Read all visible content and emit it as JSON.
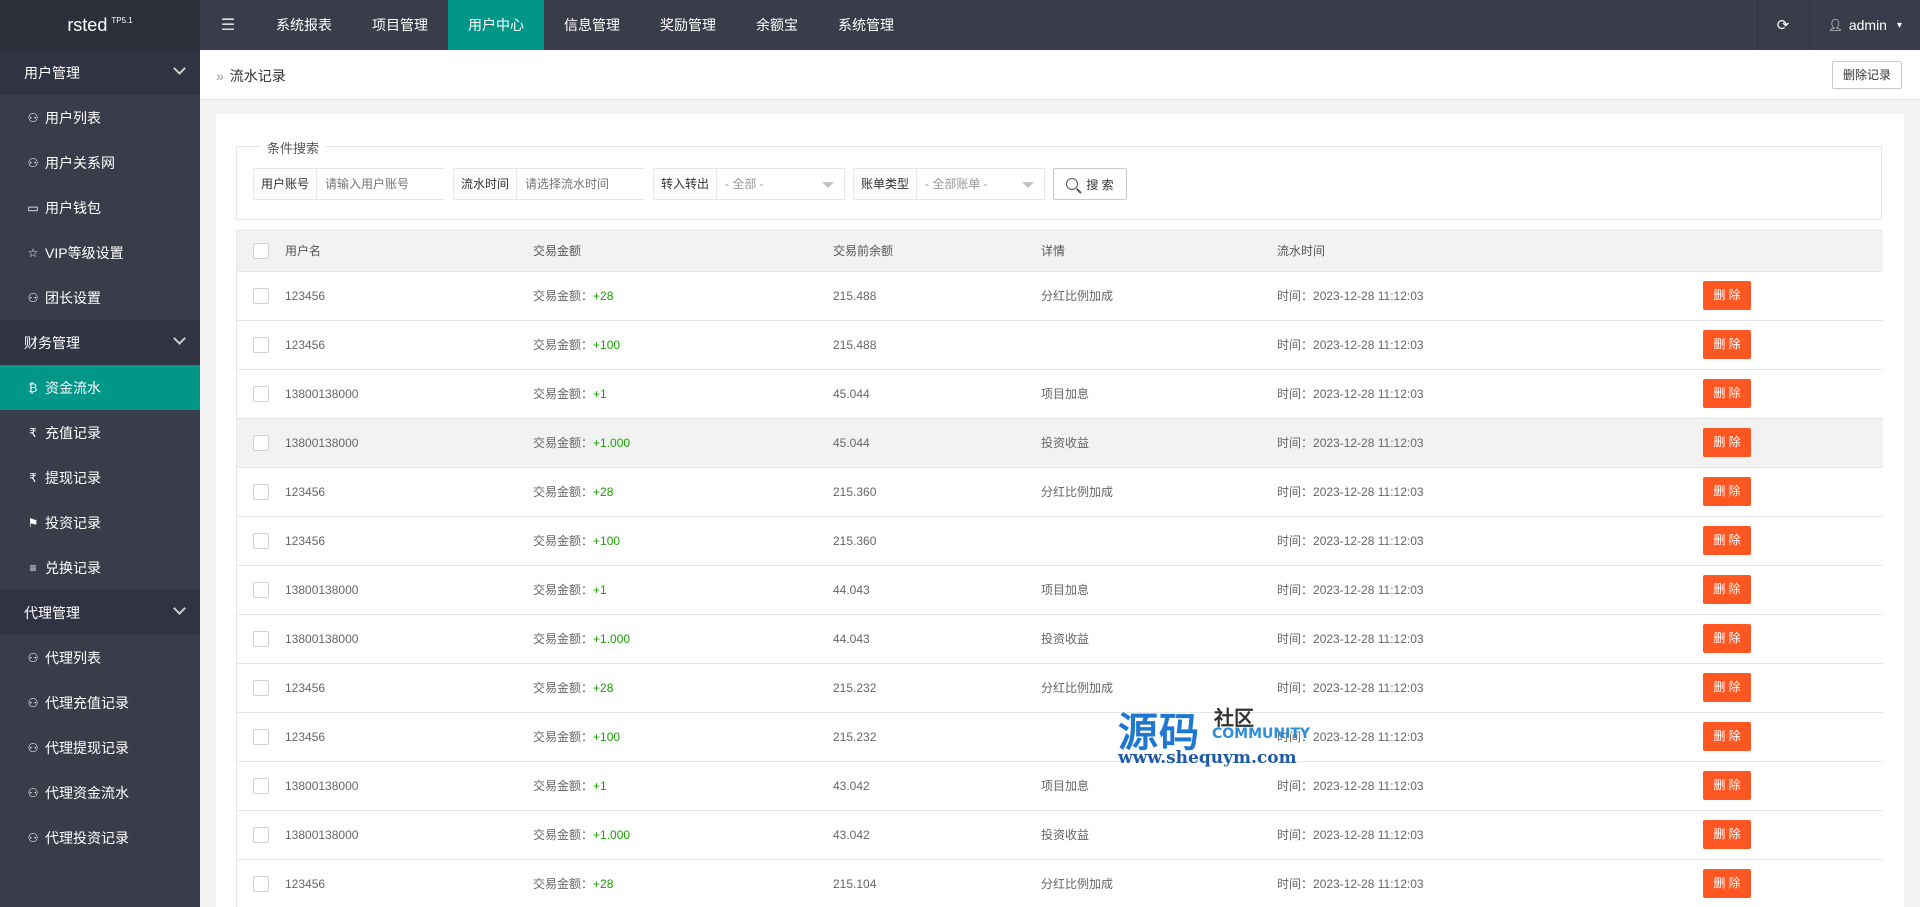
{
  "app": {
    "logo_name": "rsted",
    "logo_version": "TP5.1"
  },
  "topnav": {
    "items": [
      "系统报表",
      "项目管理",
      "用户中心",
      "信息管理",
      "奖励管理",
      "余额宝",
      "系统管理"
    ],
    "active": "用户中心",
    "user": "admin"
  },
  "sidebar": {
    "groups": [
      {
        "label": "用户管理",
        "items": [
          {
            "label": "用户列表",
            "icon": "user-icon"
          },
          {
            "label": "用户关系网",
            "icon": "users-icon"
          },
          {
            "label": "用户钱包",
            "icon": "wallet-icon"
          },
          {
            "label": "VIP等级设置",
            "icon": "star-icon"
          },
          {
            "label": "团长设置",
            "icon": "users-icon"
          }
        ]
      },
      {
        "label": "财务管理",
        "items": [
          {
            "label": "资金流水",
            "icon": "bitcoin-icon",
            "active": true
          },
          {
            "label": "充值记录",
            "icon": "rupee-icon"
          },
          {
            "label": "提现记录",
            "icon": "rupee-icon"
          },
          {
            "label": "投资记录",
            "icon": "flag-icon"
          },
          {
            "label": "兑换记录",
            "icon": "list-icon"
          }
        ]
      },
      {
        "label": "代理管理",
        "items": [
          {
            "label": "代理列表",
            "icon": "user-icon"
          },
          {
            "label": "代理充值记录",
            "icon": "user-icon"
          },
          {
            "label": "代理提现记录",
            "icon": "user-icon"
          },
          {
            "label": "代理资金流水",
            "icon": "user-icon"
          },
          {
            "label": "代理投资记录",
            "icon": "user-icon"
          }
        ]
      }
    ]
  },
  "breadcrumb": {
    "sep": "»",
    "label": "流水记录"
  },
  "delete_records_label": "删除记录",
  "search": {
    "legend": "条件搜索",
    "account_label": "用户账号",
    "account_placeholder": "请输入用户账号",
    "time_label": "流水时间",
    "time_placeholder": "请选择流水时间",
    "direction_label": "转入转出",
    "direction_value": "- 全部 -",
    "type_label": "账单类型",
    "type_value": "- 全部账单 -",
    "button_label": "搜 索"
  },
  "table": {
    "headers": [
      "用户名",
      "交易金额",
      "交易前余额",
      "详情",
      "流水时间"
    ],
    "amount_prefix": "交易金额：",
    "time_prefix": "时间：",
    "delete_label": "删 除",
    "rows": [
      {
        "user": "123456",
        "amount": "+28",
        "balance": "215.488",
        "detail": "分红比例加成",
        "time": "2023-12-28 11:12:03"
      },
      {
        "user": "123456",
        "amount": "+100",
        "balance": "215.488",
        "detail": "",
        "time": "2023-12-28 11:12:03"
      },
      {
        "user": "13800138000",
        "amount": "+1",
        "balance": "45.044",
        "detail": "项目加息",
        "time": "2023-12-28 11:12:03"
      },
      {
        "user": "13800138000",
        "amount": "+1.000",
        "balance": "45.044",
        "detail": "投资收益",
        "time": "2023-12-28 11:12:03"
      },
      {
        "user": "123456",
        "amount": "+28",
        "balance": "215.360",
        "detail": "分红比例加成",
        "time": "2023-12-28 11:12:03"
      },
      {
        "user": "123456",
        "amount": "+100",
        "balance": "215.360",
        "detail": "",
        "time": "2023-12-28 11:12:03"
      },
      {
        "user": "13800138000",
        "amount": "+1",
        "balance": "44.043",
        "detail": "项目加息",
        "time": "2023-12-28 11:12:03"
      },
      {
        "user": "13800138000",
        "amount": "+1.000",
        "balance": "44.043",
        "detail": "投资收益",
        "time": "2023-12-28 11:12:03"
      },
      {
        "user": "123456",
        "amount": "+28",
        "balance": "215.232",
        "detail": "分红比例加成",
        "time": "2023-12-28 11:12:03"
      },
      {
        "user": "123456",
        "amount": "+100",
        "balance": "215.232",
        "detail": "",
        "time": "2023-12-28 11:12:03"
      },
      {
        "user": "13800138000",
        "amount": "+1",
        "balance": "43.042",
        "detail": "项目加息",
        "time": "2023-12-28 11:12:03"
      },
      {
        "user": "13800138000",
        "amount": "+1.000",
        "balance": "43.042",
        "detail": "投资收益",
        "time": "2023-12-28 11:12:03"
      },
      {
        "user": "123456",
        "amount": "+28",
        "balance": "215.104",
        "detail": "分红比例加成",
        "time": "2023-12-28 11:12:03"
      }
    ],
    "hover_row": 3
  },
  "watermark": {
    "big": "源码",
    "small": "社区",
    "eng": "COMMUNITY",
    "url": "www.shequym.com"
  },
  "colors": {
    "header_bg": "#393d49",
    "accent": "#009688",
    "danger": "#ff5722",
    "amount": "#1aa200"
  }
}
